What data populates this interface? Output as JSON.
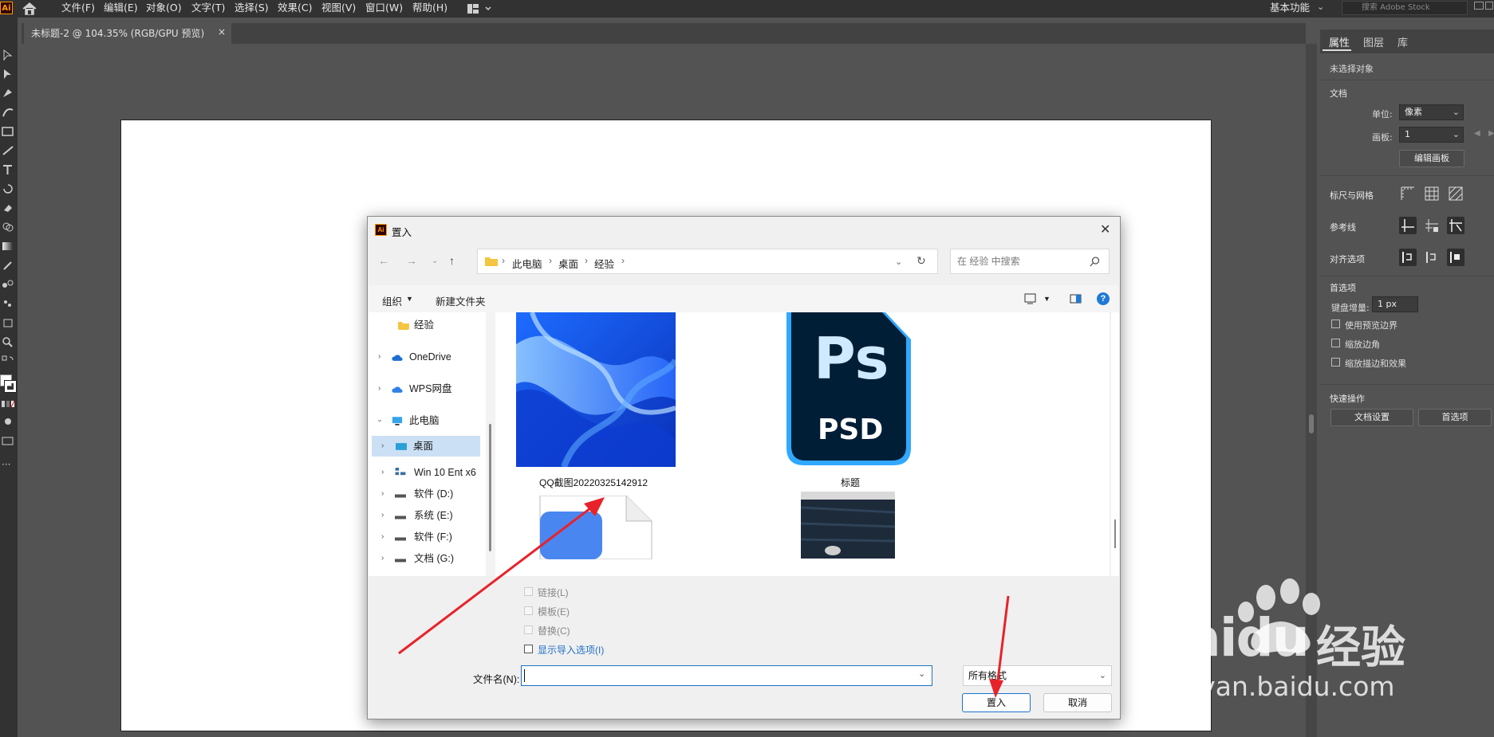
{
  "app": {
    "logo": "Ai",
    "menus": [
      "文件(F)",
      "编辑(E)",
      "对象(O)",
      "文字(T)",
      "选择(S)",
      "效果(C)",
      "视图(V)",
      "窗口(W)",
      "帮助(H)"
    ],
    "workspace": "基本功能",
    "stock_placeholder": "搜索 Adobe Stock",
    "doc_tab": "未标题-2 @ 104.35% (RGB/GPU 预览)",
    "doc_tab_close": "×"
  },
  "panel": {
    "tabs": [
      "属性",
      "图层",
      "库"
    ],
    "no_selection": "未选择对象",
    "document": "文档",
    "unit_label": "单位:",
    "unit_value": "像素",
    "artboard_label": "画板:",
    "artboard_value": "1",
    "edit_artboard_btn": "编辑画板",
    "rulers_grids": "标尺与网格",
    "guides": "参考线",
    "snap_options": "对齐选项",
    "preferences": "首选项",
    "keyboard_increment_label": "键盘增量:",
    "keyboard_increment_value": "1 px",
    "chk_preview_bounds": "使用预览边界",
    "chk_scale_corners": "缩放边角",
    "chk_scale_strokes": "缩放描边和效果",
    "quick_actions": "快速操作",
    "doc_setup_btn": "文档设置",
    "prefs_btn": "首选项"
  },
  "dialog": {
    "logo": "Ai",
    "title": "置入",
    "close": "✕",
    "breadcrumb": [
      "此电脑",
      "桌面",
      "经验"
    ],
    "search_placeholder": "在 经验 中搜索",
    "organize": "组织",
    "new_folder": "新建文件夹",
    "help": "?",
    "nav_items": [
      {
        "label": "经验",
        "icon": "folder-icon"
      },
      {
        "label": "OneDrive",
        "icon": "cloud-icon"
      },
      {
        "label": "WPS网盘",
        "icon": "cloud-icon"
      },
      {
        "label": "此电脑",
        "icon": "computer-icon"
      },
      {
        "label": "桌面",
        "icon": "desktop-icon"
      },
      {
        "label": "Win 10 Ent x6",
        "icon": "network-icon"
      },
      {
        "label": "软件 (D:)",
        "icon": "drive-icon"
      },
      {
        "label": "系统 (E:)",
        "icon": "drive-icon"
      },
      {
        "label": "软件 (F:)",
        "icon": "drive-icon"
      },
      {
        "label": "文档 (G:)",
        "icon": "drive-icon"
      }
    ],
    "files": [
      {
        "caption": "QQ截图20220325142912",
        "thumb": "blue-ribbon-image"
      },
      {
        "caption": "标题",
        "thumb": "psd-icon",
        "icon_big": "Ps",
        "icon_small": "PSD"
      }
    ],
    "options": [
      "链接(L)",
      "模板(E)",
      "替换(C)",
      "显示导入选项(I)"
    ],
    "filename_label": "文件名(N):",
    "filename_value": "",
    "filetype": "所有格式",
    "place_btn": "置入",
    "cancel_btn": "取消"
  },
  "watermark": {
    "brand": "Baidu",
    "suffix": "经验",
    "url": "jingyan.baidu.com"
  }
}
